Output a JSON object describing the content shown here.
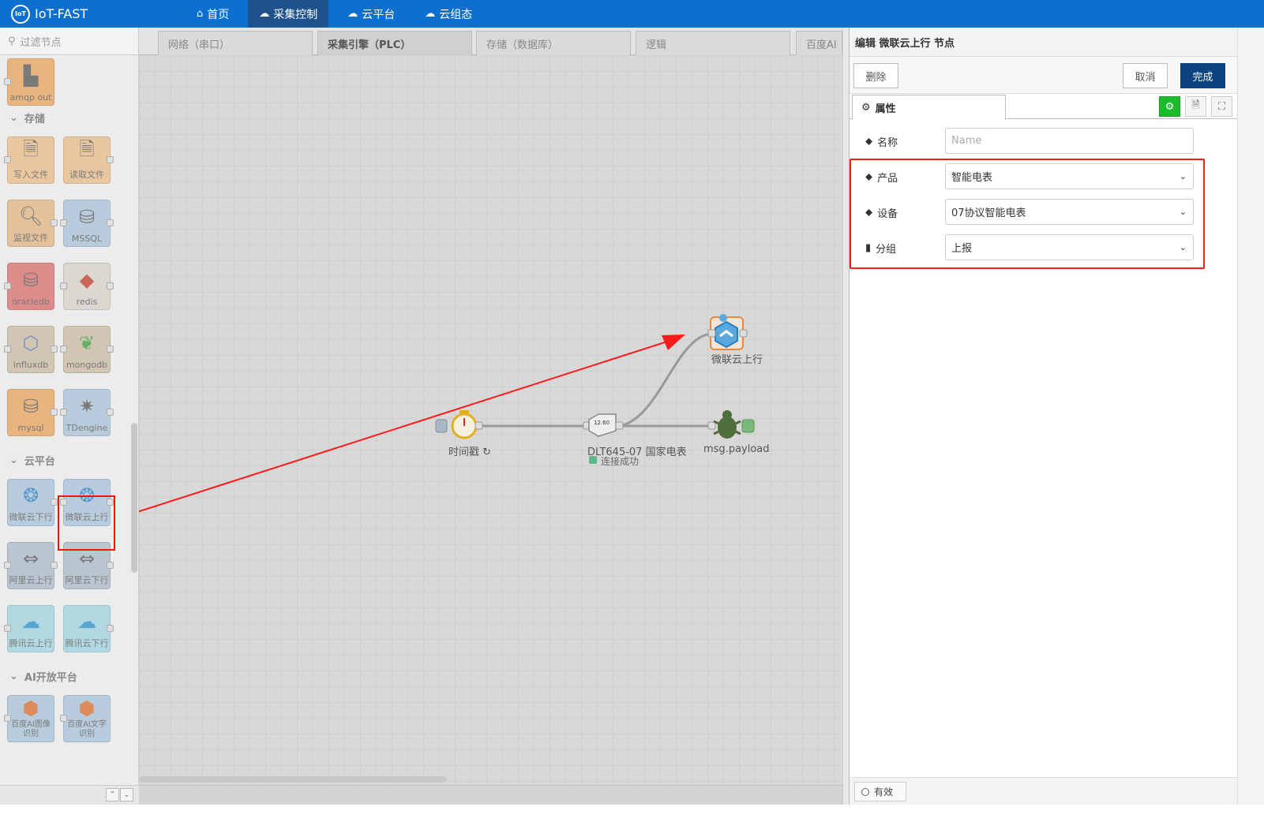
{
  "app": {
    "title": "IoT-FAST",
    "logo_text": "IoT"
  },
  "nav": [
    {
      "label": "首页",
      "icon": "⌂"
    },
    {
      "label": "采集控制",
      "icon": "☁"
    },
    {
      "label": "云平台",
      "icon": "☁"
    },
    {
      "label": "云组态",
      "icon": "☁"
    }
  ],
  "palette": {
    "filter_placeholder": "过滤节点",
    "categories": {
      "storage": "存储",
      "cloud": "云平台",
      "ai": "AI开放平台"
    },
    "nodes": {
      "amqp_out": "amqp out",
      "write_file": "写入文件",
      "read_file": "读取文件",
      "watch_file": "监视文件",
      "mssql": "MSSQL",
      "oracledb": "oracledb",
      "redis": "redis",
      "influxdb": "influxdb",
      "mongodb": "mongodb",
      "mysql": "mysql",
      "tdengine": "TDengine",
      "wl_down": "微联云下行",
      "wl_up": "微联云上行",
      "ali_up": "阿里云上行",
      "ali_down": "阿里云下行",
      "tx_up": "腾讯云上行",
      "tx_down": "腾讯云下行",
      "baidu_img": "百度AI图像识别",
      "baidu_text": "百度AI文字识别"
    },
    "colors": {
      "orange": "#e8a259",
      "light_orange": "#e9bc87",
      "blue": "#a8c2d8",
      "red": "#d96b6b",
      "brown": "#c8b8a0",
      "teal": "#9fd3df"
    }
  },
  "tabs": [
    "网络（串口）",
    "采集引擎（PLC）",
    "存储（数据库）",
    "逻辑",
    "百度AI"
  ],
  "flow": {
    "inject_label": "时间戳 ↻",
    "dlt_label": "DLT645-07 国家电表",
    "dlt_icon_text": "12.60",
    "status_text": "连接成功",
    "debug_label": "msg.payload",
    "cloud_label": "微联云上行"
  },
  "tray": {
    "header": "编辑 微联云上行 节点",
    "delete": "删除",
    "cancel": "取消",
    "done": "完成",
    "tab_properties": "属性",
    "fields": {
      "name_label": "名称",
      "name_placeholder": "Name",
      "product_label": "产品",
      "product_value": "智能电表",
      "device_label": "设备",
      "device_value": "07协议智能电表",
      "group_label": "分组",
      "group_value": "上报"
    },
    "enabled": "有效"
  },
  "accent": {
    "brand": "#0d6fce",
    "highlight": "#ff1a1a",
    "primary_button": "#0b4383",
    "success": "#1cbb2c"
  }
}
